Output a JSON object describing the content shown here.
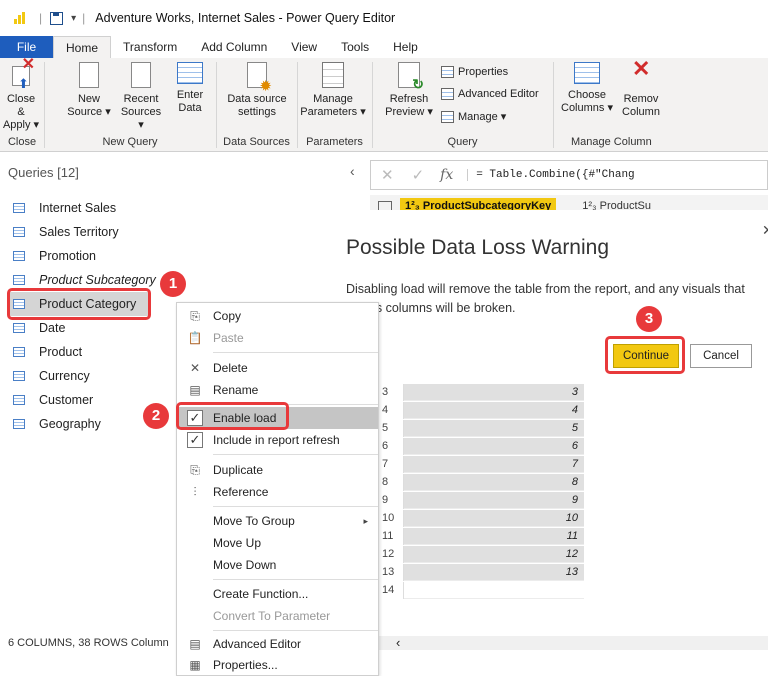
{
  "window": {
    "title": "Adventure Works, Internet Sales - Power Query Editor"
  },
  "ribbon_tabs": [
    "File",
    "Home",
    "Transform",
    "Add Column",
    "View",
    "Tools",
    "Help"
  ],
  "ribbon": {
    "close_apply": [
      "Close &",
      "Apply ▾"
    ],
    "new_source": [
      "New",
      "Source ▾"
    ],
    "recent_sources": [
      "Recent",
      "Sources ▾"
    ],
    "enter_data": [
      "Enter",
      "Data"
    ],
    "data_source_settings": [
      "Data source",
      "settings"
    ],
    "manage_parameters": [
      "Manage",
      "Parameters ▾"
    ],
    "refresh_preview": [
      "Refresh",
      "Preview ▾"
    ],
    "properties": "Properties",
    "advanced_editor": "Advanced Editor",
    "manage": "Manage ▾",
    "choose_columns": [
      "Choose",
      "Columns ▾"
    ],
    "remove_columns": [
      "Remov",
      "Column"
    ],
    "groups": [
      "Close",
      "New Query",
      "Data Sources",
      "Parameters",
      "Query",
      "Manage Column"
    ]
  },
  "queries": {
    "header": "Queries [12]",
    "items": [
      "Internet Sales",
      "Sales Territory",
      "Promotion",
      "Product Subcategory",
      "Product Category",
      "Date",
      "Product",
      "Currency",
      "Customer",
      "Geography"
    ],
    "status": "6 COLUMNS, 38 ROWS    Column"
  },
  "formula_bar": {
    "fx": "fx",
    "formula": "= Table.Combine({#\"Chang"
  },
  "columns": {
    "c1": "1²₃ ProductSubcategoryKey",
    "c2": "1²₃ ProductSu"
  },
  "grid_rows": [
    {
      "n": "3",
      "v": "3"
    },
    {
      "n": "4",
      "v": "4"
    },
    {
      "n": "5",
      "v": "5"
    },
    {
      "n": "6",
      "v": "6"
    },
    {
      "n": "7",
      "v": "7"
    },
    {
      "n": "8",
      "v": "8"
    },
    {
      "n": "9",
      "v": "9"
    },
    {
      "n": "10",
      "v": "10"
    },
    {
      "n": "11",
      "v": "11"
    },
    {
      "n": "12",
      "v": "12"
    },
    {
      "n": "13",
      "v": "13"
    },
    {
      "n": "14",
      "v": ""
    }
  ],
  "dialog": {
    "title": "Possible Data Loss Warning",
    "message": "Disabling load will remove the table from the report, and any visuals that use its columns will be broken.",
    "continue": "Continue",
    "cancel": "Cancel"
  },
  "context_menu": {
    "copy": "Copy",
    "paste": "Paste",
    "delete": "Delete",
    "rename": "Rename",
    "enable_load": "Enable load",
    "include_refresh": "Include in report refresh",
    "duplicate": "Duplicate",
    "reference": "Reference",
    "move_to_group": "Move To Group",
    "move_up": "Move Up",
    "move_down": "Move Down",
    "create_function": "Create Function...",
    "convert_param": "Convert To Parameter",
    "advanced_editor": "Advanced Editor",
    "properties": "Properties..."
  },
  "badges": [
    "1",
    "2",
    "3"
  ],
  "colors": {
    "accent_yellow": "#f2c811",
    "file_tab": "#1e5dbd",
    "annotation_red": "#e8393b"
  }
}
